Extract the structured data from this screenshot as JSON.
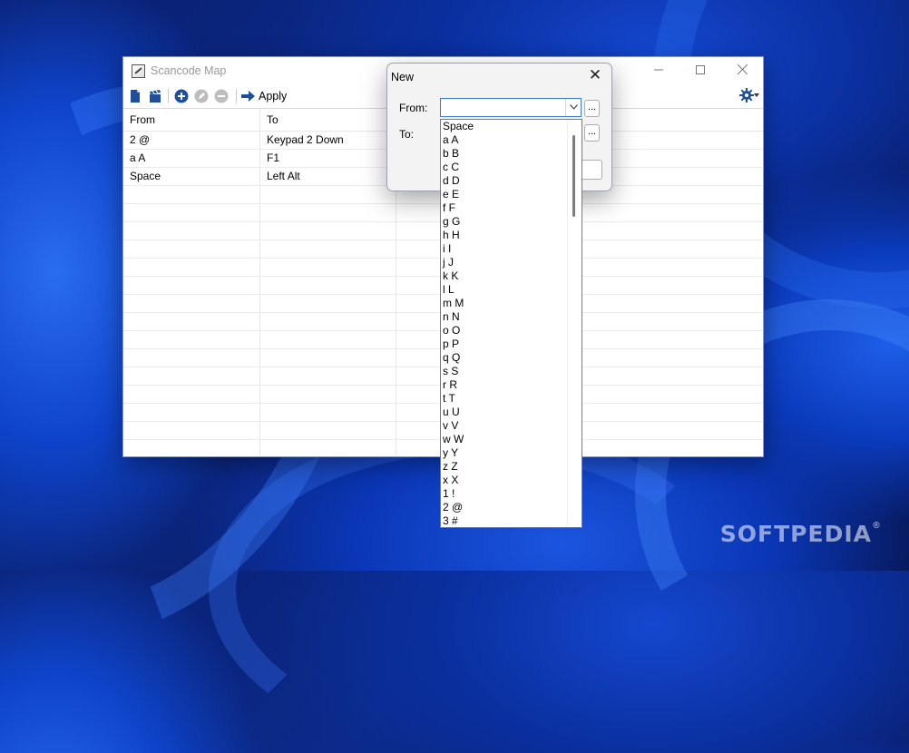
{
  "main_window": {
    "title": "Scancode Map",
    "toolbar": {
      "apply_label": "Apply"
    },
    "columns": [
      "From",
      "To"
    ],
    "rows": [
      {
        "from": "2 @",
        "to": "Keypad 2 Down"
      },
      {
        "from": "a A",
        "to": "F1"
      },
      {
        "from": "Space",
        "to": "Left Alt"
      }
    ]
  },
  "dialog": {
    "title": "New",
    "close_glyph": "✕",
    "from_label": "From:",
    "to_label": "To:",
    "browse_label": "...",
    "from_value": "",
    "options": [
      "Space",
      "a A",
      "b B",
      "c C",
      "d D",
      "e E",
      "f F",
      "g G",
      "h H",
      "i I",
      "j J",
      "k K",
      "l L",
      "m M",
      "n N",
      "o O",
      "p P",
      "q Q",
      "s S",
      "r R",
      "t T",
      "u U",
      "v V",
      "w W",
      "y Y",
      "z Z",
      "x X",
      "1 !",
      "2 @",
      "3 #"
    ]
  },
  "watermark": {
    "text": "SOFTPEDIA",
    "mark": "®"
  },
  "colors": {
    "accent": "#3d7ad6",
    "toolbar_icon": "#1f4e9c",
    "desktop": "#0b2a8a"
  }
}
